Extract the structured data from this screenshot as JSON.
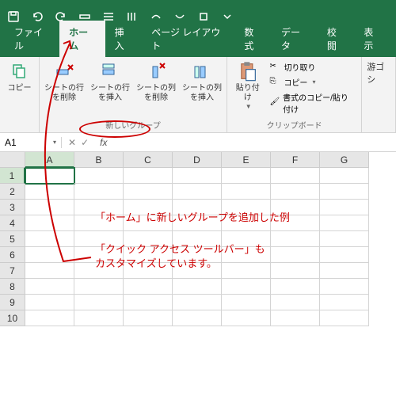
{
  "qat": {
    "icons": [
      "save-icon",
      "undo-icon",
      "redo-icon",
      "insert-row-icon",
      "insert-rows-icon",
      "stripe-icon",
      "shape1-icon",
      "shape2-icon",
      "shape3-icon"
    ]
  },
  "tabs": {
    "file": "ファイル",
    "home": "ホーム",
    "insert": "挿入",
    "pagelayout": "ページ レイアウト",
    "formula": "数式",
    "data": "データ",
    "review": "校閲",
    "view": "表示"
  },
  "ribbon": {
    "copy": "コピー",
    "delete_row": "シートの行\nを削除",
    "insert_row": "シートの行\nを挿入",
    "delete_col": "シートの列\nを削除",
    "insert_col": "シートの列\nを挿入",
    "new_group": "新しいグループ",
    "paste": "貼り付け",
    "cut": "切り取り",
    "copy2": "コピー",
    "format_painter": "書式のコピー/貼り付け",
    "clipboard": "クリップボード",
    "font_name": "游ゴシ"
  },
  "namebox": {
    "value": "A1",
    "fx": "fx"
  },
  "columns": [
    "A",
    "B",
    "C",
    "D",
    "E",
    "F",
    "G"
  ],
  "rows": [
    "1",
    "2",
    "3",
    "4",
    "5",
    "6",
    "7",
    "8",
    "9",
    "10"
  ],
  "annotation": {
    "line1": "「ホーム」に新しいグループを追加した例",
    "line2": "「クイック アクセス ツールバー」も\nカスタマイズしています。"
  }
}
